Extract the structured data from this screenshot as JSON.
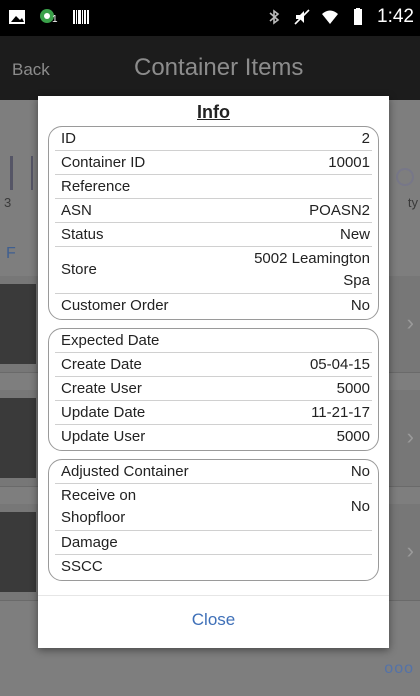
{
  "status_bar": {
    "time": "1:42",
    "icons": [
      "gallery-icon",
      "notification-badge-icon",
      "barcode-icon",
      "bluetooth-icon",
      "mute-icon",
      "wifi-icon",
      "battery-icon"
    ],
    "badge_count": "1"
  },
  "header": {
    "back_label": "Back",
    "title": "Container Items"
  },
  "background": {
    "partial_3": "3",
    "partial_ty": "ty",
    "partial_f": "F",
    "more_label": "ooo"
  },
  "dialog": {
    "title": "Info",
    "groups": [
      {
        "rows": [
          {
            "label": "ID",
            "value": "2"
          },
          {
            "label": "Container ID",
            "value": "10001"
          },
          {
            "label": "Reference",
            "value": ""
          },
          {
            "label": "ASN",
            "value": "POASN2"
          },
          {
            "label": "Status",
            "value": "New"
          },
          {
            "label": "Store",
            "value": "5002 Leamington Spa"
          },
          {
            "label": "Customer Order",
            "value": "No"
          }
        ]
      },
      {
        "rows": [
          {
            "label": "Expected Date",
            "value": ""
          },
          {
            "label": "Create Date",
            "value": "05-04-15"
          },
          {
            "label": "Create User",
            "value": "5000"
          },
          {
            "label": "Update Date",
            "value": "11-21-17"
          },
          {
            "label": "Update User",
            "value": "5000"
          }
        ]
      },
      {
        "rows": [
          {
            "label": "Adjusted Container",
            "value": "No"
          },
          {
            "label": "Receive on Shopfloor",
            "value": "No"
          },
          {
            "label": "Damage",
            "value": ""
          },
          {
            "label": "SSCC",
            "value": ""
          }
        ]
      }
    ],
    "close_label": "Close"
  },
  "colors": {
    "accent": "#3f70b8",
    "status_bar": "#000000",
    "title_bar": "#1c1c1c",
    "overlay": "#7a7a7a"
  }
}
